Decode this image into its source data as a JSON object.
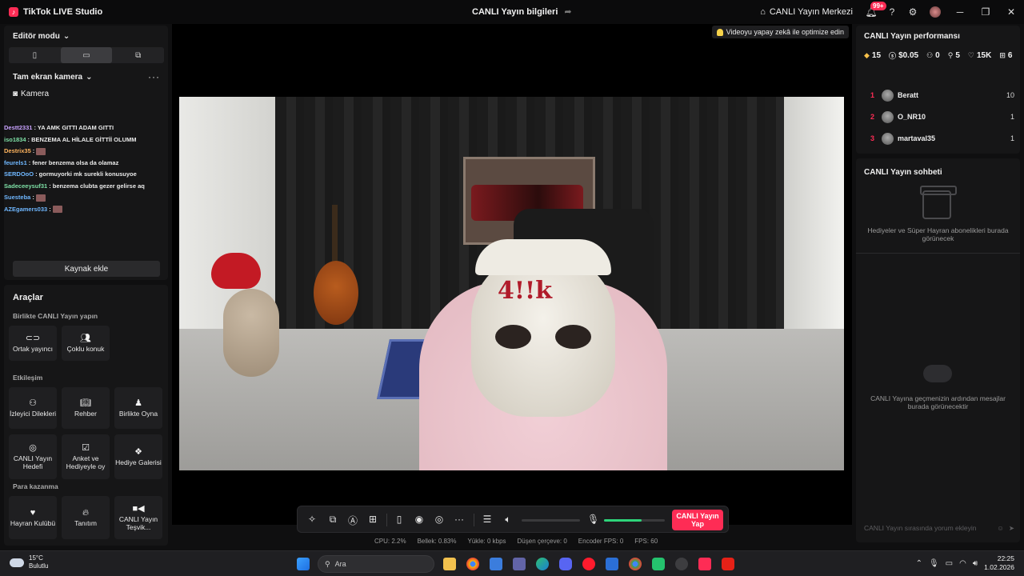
{
  "titlebar": {
    "app_title": "TikTok LIVE Studio",
    "center_title": "CANLI Yayın bilgileri",
    "live_center": "CANLI Yayın Merkezi",
    "notif_badge": "99+"
  },
  "left": {
    "editor_mode": "Editör modu",
    "fullscreen_camera": "Tam ekran kamera",
    "camera_label": "Kamera",
    "add_source": "Kaynak ekle",
    "chat": [
      {
        "user": "Destt2331",
        "text": ": YA AMK GITTI ADAM GITTI",
        "color": "purple"
      },
      {
        "user": "iso1834",
        "text": ": BENZEMA AL HİLALE GİTTİİ OLUMM",
        "color": "green"
      },
      {
        "user": "Destrix35",
        "text": ":",
        "color": "orange",
        "sticker": true
      },
      {
        "user": "feurels1",
        "text": ": fener benzema olsa da olamaz",
        "color": "blue"
      },
      {
        "user": "SERDOoO",
        "text": ": gormuyorki mk surekli konusuyoe",
        "color": "blue"
      },
      {
        "user": "Sadeceeysuf31",
        "text": ": benzema clubta gezer gelirse aq",
        "color": "green"
      },
      {
        "user": "Suesteba",
        "text": ":",
        "color": "blue",
        "sticker": true
      },
      {
        "user": "AZEgamers033",
        "text": ":",
        "color": "blue",
        "sticker": true
      }
    ]
  },
  "tools": {
    "title": "Araçlar",
    "section_together": "Birlikte CANLI Yayın yapın",
    "section_interaction": "Etkileşim",
    "section_monetization": "Para kazanma",
    "cohost": "Ortak yayıncı",
    "multi_guest": "Çoklu konuk",
    "viewer_requests": "İzleyici Dilekleri",
    "guide": "Rehber",
    "play_together": "Birlikte Oyna",
    "live_goal": "CANLI Yayın Hedefi",
    "poll": "Anket ve Hediyeyle oy",
    "gift_gallery": "Hediye Galerisi",
    "fan_club": "Hayran Kulübü",
    "promote": "Tanıtım",
    "live_incentive": "CANLI Yayın Teşvik..."
  },
  "stage": {
    "optimize": "Videoyu yapay zekâ ile optimize edin",
    "mask_text": "4!!k",
    "go_live": "CANLI Yayın Yap",
    "mic_level": 0.62,
    "stats": {
      "cpu": "CPU:  2.2%",
      "memory": "Bellek:  0.83%",
      "upload": "Yükle:  0 kbps",
      "dropped": "Düşen çerçeve:  0",
      "encoder_fps": "Encoder FPS:  0",
      "fps": "FPS:  60"
    }
  },
  "right": {
    "perf_title": "CANLI Yayın performansı",
    "metrics": {
      "gems": "15",
      "earnings": "$0.05",
      "followers": "0",
      "shares": "5",
      "likes": "15K",
      "gifts": "6"
    },
    "ranking": [
      {
        "rank": "1",
        "name": "Beratt",
        "score": "10"
      },
      {
        "rank": "2",
        "name": "O_NR10",
        "score": "1"
      },
      {
        "rank": "3",
        "name": "martaval35",
        "score": "1"
      }
    ],
    "chat_title": "CANLI Yayın sohbeti",
    "gifts_empty": "Hediyeler ve Süper Hayran abonelikleri burada görünecek",
    "chat_empty": "CANLI Yayına geçmenizin ardından mesajlar burada görünecektir",
    "chat_placeholder": "CANLI Yayın sırasında yorum ekleyin"
  },
  "taskbar": {
    "temp": "15°C",
    "weather": "Bulutlu",
    "search": "Ara",
    "time": "22:25",
    "date": "1.02.2026"
  },
  "colors": {
    "accent": "#fe2c55",
    "mic_level": "#2ed47a"
  }
}
